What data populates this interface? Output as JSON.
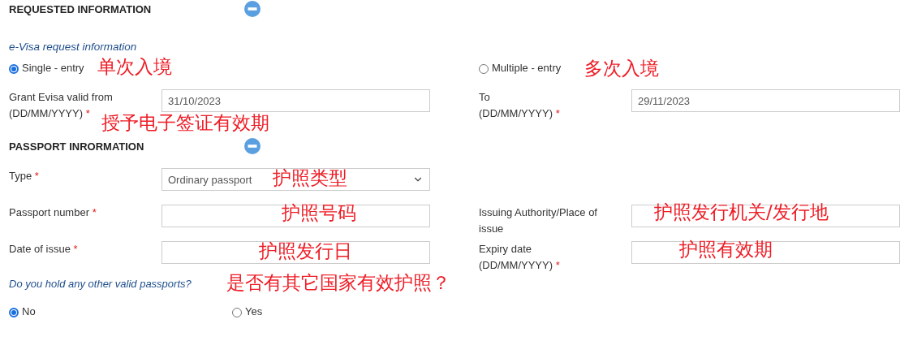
{
  "requested": {
    "title": "REQUESTED INFORMATION",
    "expanded": true,
    "subtitle": "e-Visa request information",
    "entry_options": [
      {
        "label": "Single - entry",
        "selected": true,
        "annotation": "单次入境"
      },
      {
        "label": "Multiple - entry",
        "selected": false,
        "annotation": "多次入境"
      }
    ],
    "valid_from": {
      "label": "Grant Evisa valid from",
      "format": "(DD/MM/YYYY)",
      "required_mark": "*",
      "value": "31/10/2023",
      "annotation": "授予电子签证有效期"
    },
    "valid_to": {
      "label": "To",
      "format": "(DD/MM/YYYY)",
      "required_mark": "*",
      "value": "29/11/2023"
    }
  },
  "passport": {
    "title": "PASSPORT INRORMATION",
    "expanded": true,
    "type": {
      "label": "Type",
      "required_mark": "*",
      "value": "Ordinary passport",
      "annotation": "护照类型"
    },
    "number": {
      "label": "Passport number",
      "required_mark": "*",
      "annotation": "护照号码"
    },
    "authority": {
      "label": "Issuing Authority/Place of issue",
      "annotation": "护照发行机关/发行地"
    },
    "issue_date": {
      "label": "Date of issue",
      "required_mark": "*",
      "annotation": "护照发行日"
    },
    "expiry_date": {
      "label": "Expiry date",
      "format": "(DD/MM/YYYY)",
      "required_mark": "*",
      "annotation": "护照有效期"
    },
    "other_passports": {
      "question": "Do you hold any other valid passports?",
      "annotation": "是否有其它国家有效护照？",
      "options": [
        {
          "label": "No",
          "selected": true
        },
        {
          "label": "Yes",
          "selected": false
        }
      ]
    }
  }
}
